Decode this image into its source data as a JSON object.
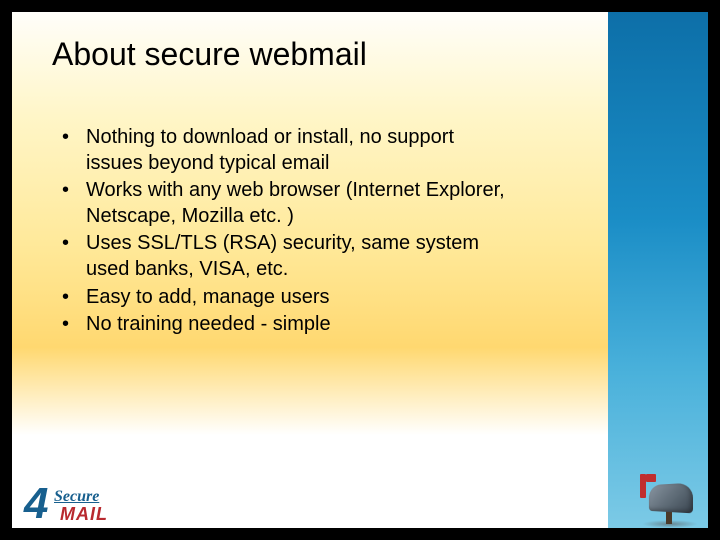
{
  "slide": {
    "title": "About secure webmail",
    "bullets": [
      "Nothing to download or install, no support issues beyond typical email",
      "Works with any web browser (Internet Explorer, Netscape, Mozilla etc. )",
      "Uses SSL/TLS (RSA) security, same system used banks, VISA, etc.",
      "Easy to add, manage users",
      "No training needed - simple"
    ]
  },
  "brand": {
    "four": "4",
    "secure": "Secure",
    "mail": "MAIL"
  }
}
